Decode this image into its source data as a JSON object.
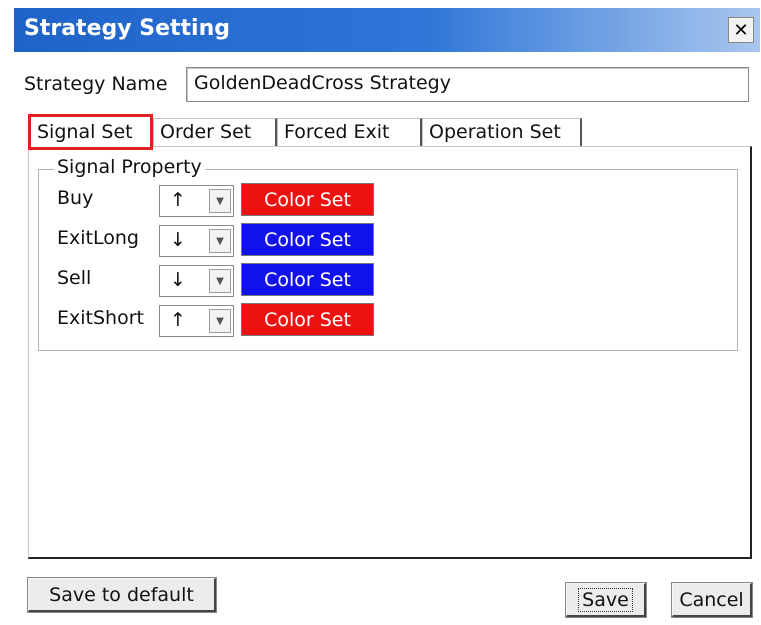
{
  "window": {
    "title": "Strategy Setting",
    "close_glyph": "✕"
  },
  "strategy_name": {
    "label": "Strategy Name",
    "value": "GoldenDeadCross Strategy"
  },
  "tabs": [
    {
      "label": "Signal Set",
      "active": true
    },
    {
      "label": "Order Set",
      "active": false
    },
    {
      "label": "Forced  Exit",
      "active": false
    },
    {
      "label": "Operation Set",
      "active": false
    }
  ],
  "signal_property": {
    "title": "Signal Property",
    "rows": [
      {
        "label": "Buy",
        "arrow": "↑",
        "button": "Color Set",
        "color": "#ee1111"
      },
      {
        "label": "ExitLong",
        "arrow": "↓",
        "button": "Color Set",
        "color": "#1111ee"
      },
      {
        "label": "Sell",
        "arrow": "↓",
        "button": "Color Set",
        "color": "#1111ee"
      },
      {
        "label": "ExitShort",
        "arrow": "↑",
        "button": "Color Set",
        "color": "#ee1111"
      }
    ]
  },
  "buttons": {
    "save_default": "Save to default",
    "save": "Save",
    "cancel": "Cancel"
  },
  "colors": {
    "titlebar": "#1f63c8",
    "active_tab_highlight": "#e02020"
  },
  "icons": {
    "close": "close-icon",
    "combo_arrow": "chevron-down-icon"
  }
}
